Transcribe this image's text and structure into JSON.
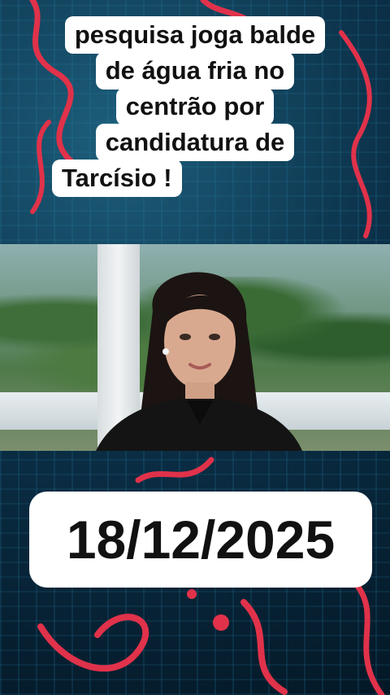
{
  "headline": {
    "lines": [
      "pesquisa joga balde",
      "de água fria no",
      "centrão por",
      "candidatura de",
      "Tarcísio !"
    ]
  },
  "date_caption": "18/12/2025",
  "colors": {
    "caption_bg": "#ffffff",
    "caption_text": "#111111",
    "background": "#07243a",
    "accent_scribble": "#e0324a"
  }
}
